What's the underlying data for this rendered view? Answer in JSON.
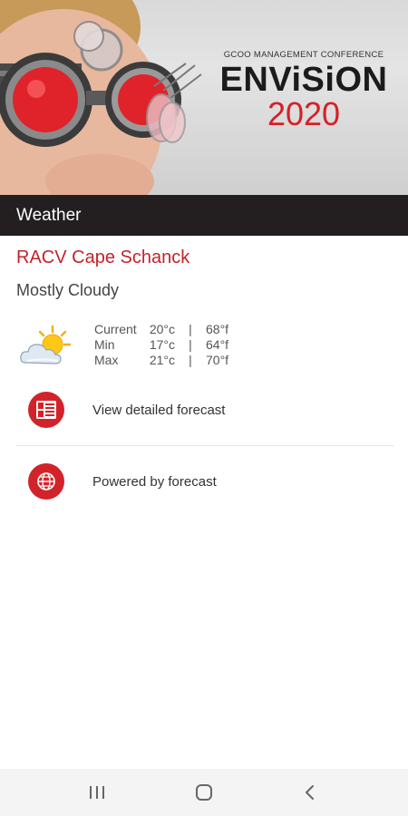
{
  "banner": {
    "kicker": "GCOO MANAGEMENT CONFERENCE",
    "title": "ENViSiON",
    "year": "2020"
  },
  "section": {
    "title": "Weather"
  },
  "weather": {
    "location": "RACV Cape Schanck",
    "condition": "Mostly Cloudy",
    "icon": "partly-cloudy-icon",
    "rows": [
      {
        "label": "Current",
        "celsius": "20°c",
        "separator": "|",
        "fahrenheit": "68°f"
      },
      {
        "label": "Min",
        "celsius": "17°c",
        "separator": "|",
        "fahrenheit": "64°f"
      },
      {
        "label": "Max",
        "celsius": "21°c",
        "separator": "|",
        "fahrenheit": "70°f"
      }
    ]
  },
  "actions": [
    {
      "label": "View detailed forecast",
      "icon": "forecast-list-icon"
    },
    {
      "label": "Powered by forecast",
      "icon": "globe-icon"
    }
  ],
  "colors": {
    "accent": "#d2232a",
    "header_bg": "#231f20"
  },
  "navbar": {
    "buttons": [
      "recent-apps-icon",
      "home-icon",
      "back-icon"
    ]
  }
}
